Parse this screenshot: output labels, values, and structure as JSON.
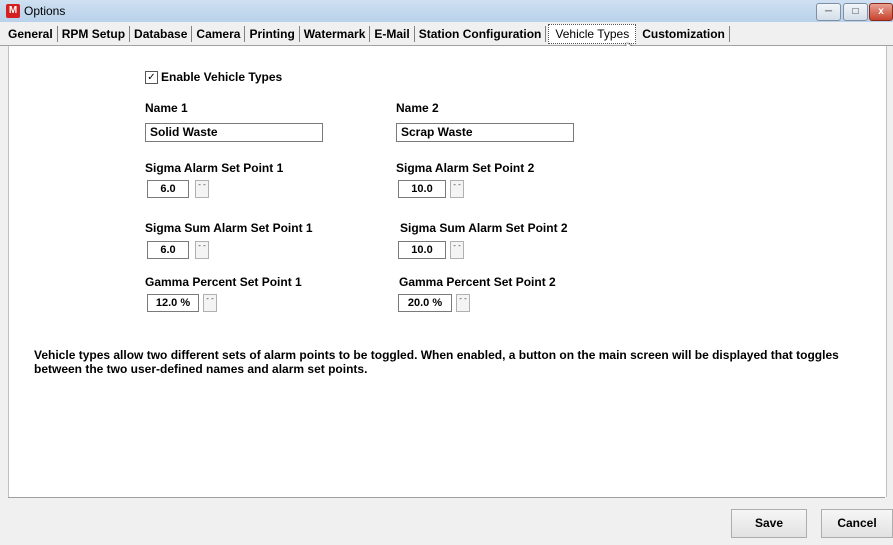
{
  "window": {
    "title": "Options",
    "app_icon_letter": "M",
    "min_symbol": "─",
    "max_symbol": "□",
    "close_symbol": "x"
  },
  "tabs": [
    {
      "label": "General"
    },
    {
      "label": "RPM Setup"
    },
    {
      "label": "Database"
    },
    {
      "label": "Camera"
    },
    {
      "label": "Printing"
    },
    {
      "label": "Watermark"
    },
    {
      "label": "E-Mail"
    },
    {
      "label": "Station Configuration"
    },
    {
      "label": "Vehicle Types",
      "active": true
    },
    {
      "label": "Customization"
    }
  ],
  "form": {
    "enable_label": "Enable Vehicle Types",
    "enable_checked": true,
    "check_mark": "✓",
    "name1_label": "Name 1",
    "name1_value": "Solid Waste",
    "name2_label": "Name 2",
    "name2_value": "Scrap Waste",
    "sigma1_label": "Sigma Alarm Set Point 1",
    "sigma1_value": "6.0",
    "sigma2_label": "Sigma Alarm Set Point 2",
    "sigma2_value": "10.0",
    "sigmasum1_label": "Sigma Sum Alarm Set Point 1",
    "sigmasum1_value": "6.0",
    "sigmasum2_label": "Sigma Sum Alarm Set Point 2",
    "sigmasum2_value": "10.0",
    "gamma1_label": "Gamma Percent Set Point 1",
    "gamma1_value": "12.0 %",
    "gamma2_label": "Gamma Percent Set Point 2",
    "gamma2_value": "20.0 %",
    "spin_symbol": "- -"
  },
  "description": "Vehicle types allow two different sets of alarm points to be toggled.  When enabled, a button on the main screen will be displayed that toggles between the two user-defined names and alarm set points.",
  "buttons": {
    "save": "Save",
    "cancel": "Cancel"
  }
}
